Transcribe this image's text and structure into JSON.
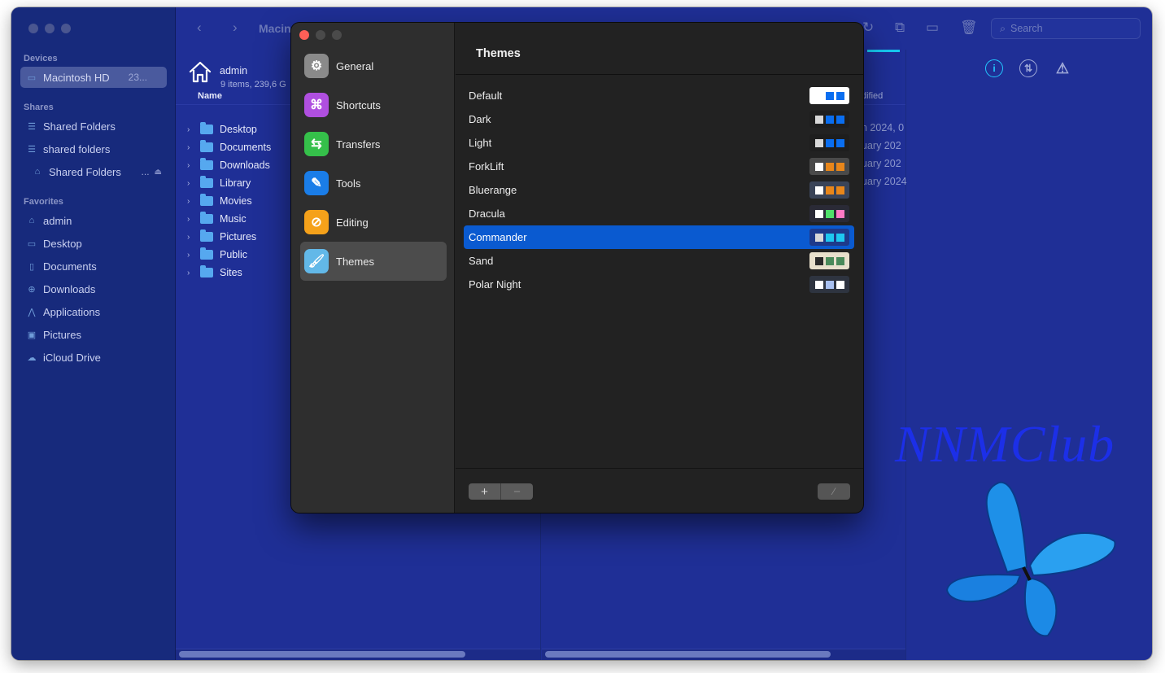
{
  "sidebar": {
    "sections": {
      "devices": "Devices",
      "shares": "Shares",
      "favorites": "Favorites"
    },
    "devices": [
      {
        "label": "Macintosh HD",
        "extra": "23...",
        "icon": "disk-icon"
      }
    ],
    "shares": [
      {
        "label": "Shared Folders",
        "icon": "server-icon"
      },
      {
        "label": "shared folders",
        "icon": "server-icon"
      },
      {
        "label": "Shared Folders",
        "extra": "...",
        "icon": "network-disk-icon"
      }
    ],
    "favorites": [
      {
        "label": "admin",
        "icon": "home-icon"
      },
      {
        "label": "Desktop",
        "icon": "desktop-icon"
      },
      {
        "label": "Documents",
        "icon": "document-icon"
      },
      {
        "label": "Downloads",
        "icon": "download-icon"
      },
      {
        "label": "Applications",
        "icon": "applications-icon"
      },
      {
        "label": "Pictures",
        "icon": "pictures-icon"
      },
      {
        "label": "iCloud Drive",
        "icon": "cloud-icon"
      }
    ]
  },
  "toolbar": {
    "title": "Macin",
    "search_placeholder": "Search"
  },
  "left_pane": {
    "location_title": "admin",
    "location_info": "9 items, 239,6 G",
    "column_name": "Name",
    "files": [
      "Desktop",
      "Documents",
      "Downloads",
      "Library",
      "Movies",
      "Music",
      "Pictures",
      "Public",
      "Sites"
    ]
  },
  "right_pane": {
    "column_modified": "dified",
    "dates": [
      "n 2024, 0",
      "uary 202",
      "uary 202",
      "uary 2024"
    ]
  },
  "watermark": "NNMClub",
  "preferences": {
    "nav": [
      {
        "label": "General",
        "icon": "gear-icon",
        "color": "#8a8a8a"
      },
      {
        "label": "Shortcuts",
        "icon": "command-icon",
        "color": "#b04fe0"
      },
      {
        "label": "Transfers",
        "icon": "transfer-arrows-icon",
        "color": "#35c04a"
      },
      {
        "label": "Tools",
        "icon": "wrench-icon",
        "color": "#1a7de8"
      },
      {
        "label": "Editing",
        "icon": "pencil-icon",
        "color": "#f5a11a"
      },
      {
        "label": "Themes",
        "icon": "paintbrush-icon",
        "color": "#62b8e8"
      }
    ],
    "selected": "Themes",
    "title": "Themes",
    "themes": [
      {
        "name": "Default",
        "bg": "#ffffff",
        "c1": "#ffffff",
        "c2": "#0a6ef0",
        "c3": "#0a6ef0"
      },
      {
        "name": "Dark",
        "bg": "#1e1e1e",
        "c1": "#d8d8d8",
        "c2": "#0a6ef0",
        "c3": "#0a6ef0"
      },
      {
        "name": "Light",
        "bg": "#1e1e1e",
        "c1": "#d8d8d8",
        "c2": "#0a6ef0",
        "c3": "#0a6ef0"
      },
      {
        "name": "ForkLift",
        "bg": "#4a4a4a",
        "c1": "#ffffff",
        "c2": "#e8861a",
        "c3": "#e8861a"
      },
      {
        "name": "Bluerange",
        "bg": "#3a4458",
        "c1": "#ffffff",
        "c2": "#e8861a",
        "c3": "#e8861a"
      },
      {
        "name": "Dracula",
        "bg": "#2a2a36",
        "c1": "#ffffff",
        "c2": "#50e06a",
        "c3": "#ff79c6"
      },
      {
        "name": "Commander",
        "bg": "#1e3a8a",
        "c1": "#d8d8d8",
        "c2": "#1ec8f0",
        "c3": "#1ec8f0"
      },
      {
        "name": "Sand",
        "bg": "#e8e0cc",
        "c1": "#2a2a2a",
        "c2": "#4a8a5a",
        "c3": "#4a8a5a"
      },
      {
        "name": "Polar Night",
        "bg": "#2e3440",
        "c1": "#ffffff",
        "c2": "#a8c0f0",
        "c3": "#ffffff"
      }
    ],
    "selected_theme": "Commander",
    "add_label": "+",
    "remove_label": "−",
    "edit_label": "⁄"
  }
}
